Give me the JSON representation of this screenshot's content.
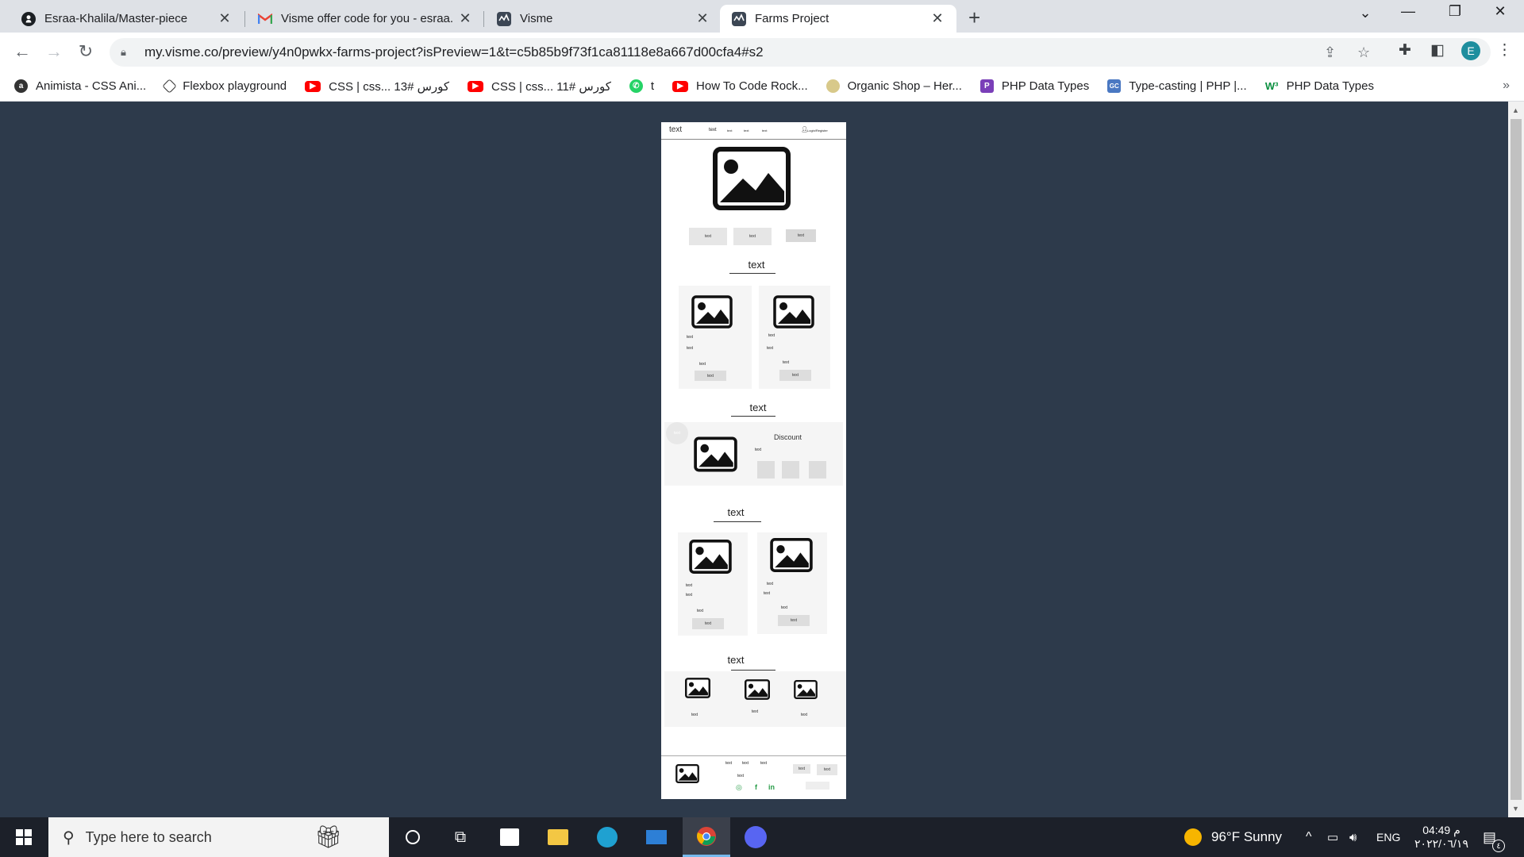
{
  "tabs": [
    {
      "title": "Esraa-Khalila/Master-piece",
      "icon": "github-icon"
    },
    {
      "title": "Visme offer code for you - esraa.k",
      "icon": "gmail-icon"
    },
    {
      "title": "Visme",
      "icon": "visme-icon"
    },
    {
      "title": "Farms Project",
      "icon": "visme-icon",
      "active": true
    }
  ],
  "url": "my.visme.co/preview/y4n0pwkx-farms-project?isPreview=1&t=c5b85b9f73f1ca81118e8a667d00cfa4#s2",
  "profile_initial": "E",
  "bookmarks": [
    {
      "label": "Animista - CSS Ani...",
      "icon": "animista-icon",
      "color": "#333"
    },
    {
      "label": "Flexbox playground",
      "icon": "codepen-icon",
      "color": "#333"
    },
    {
      "label": "CSS | css... كورس #13",
      "icon": "youtube-icon",
      "color": "#ff0000"
    },
    {
      "label": "CSS | css... كورس #11",
      "icon": "youtube-icon",
      "color": "#ff0000"
    },
    {
      "label": "t",
      "icon": "whatsapp-icon",
      "color": "#25d366"
    },
    {
      "label": "How To Code Rock...",
      "icon": "youtube-icon",
      "color": "#ff0000"
    },
    {
      "label": "Organic Shop – Her...",
      "icon": "organic-icon",
      "color": "#c9b56a"
    },
    {
      "label": "PHP Data Types",
      "icon": "php-p-icon",
      "color": "#7a3fb8"
    },
    {
      "label": "Type-casting | PHP |...",
      "icon": "gc-icon",
      "color": "#4a78c2"
    },
    {
      "label": "PHP Data Types",
      "icon": "w3-icon",
      "color": "#0a8f3f"
    }
  ],
  "mockup": {
    "nav_logo": "text",
    "nav_links": [
      "text",
      "text",
      "text",
      "text"
    ],
    "nav_login": "Login/Register",
    "hero_buttons": [
      "text",
      "text",
      "text"
    ],
    "section1_title": "text",
    "section2_title": "text",
    "section3_title": "text",
    "section4_title": "text",
    "discount_label": "Discount",
    "discount_badge": "text",
    "small_text": "text",
    "footer_links": [
      "text",
      "text",
      "text"
    ],
    "footer_text": "text",
    "footer_buttons": [
      "text",
      "text"
    ]
  },
  "taskbar": {
    "search_placeholder": "Type here to search",
    "weather": "96°F  Sunny",
    "language": "ENG",
    "time": "04:49 م",
    "date": "٢٠٢٢/٠٦/١٩",
    "notification_count": "٤"
  }
}
